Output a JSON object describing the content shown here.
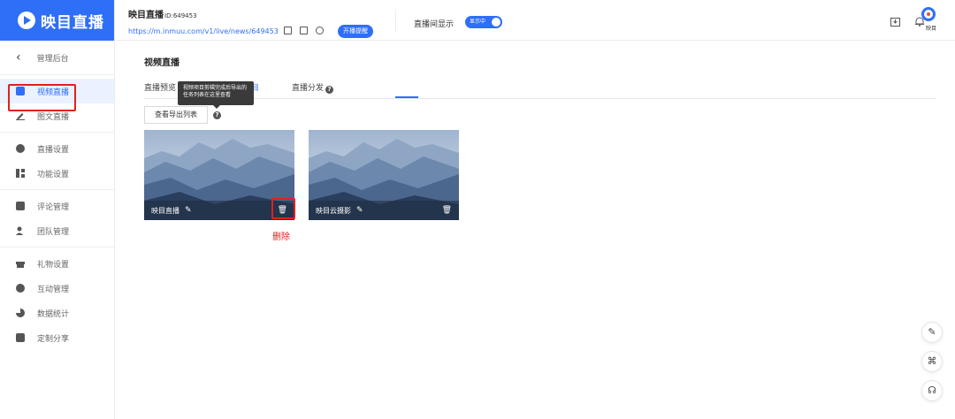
{
  "app": {
    "logo_text": "映目直播"
  },
  "header": {
    "title": "映目直播",
    "id_label": "ID:649453",
    "url": "https://m.inmuu.com/v1/live/news/649453",
    "remind_button": "开播提醒",
    "display_label": "直播间显示",
    "display_toggle": "显示中",
    "avatar_label": "映目"
  },
  "sidebar": {
    "back_label": "管理后台",
    "groups": [
      [
        {
          "label": "视频直播",
          "icon": "play-icon"
        },
        {
          "label": "图文直播",
          "icon": "pen-icon"
        }
      ],
      [
        {
          "label": "直播设置",
          "icon": "settings-icon"
        },
        {
          "label": "功能设置",
          "icon": "grid-icon"
        }
      ],
      [
        {
          "label": "评论管理",
          "icon": "comment-icon"
        },
        {
          "label": "团队管理",
          "icon": "team-icon"
        }
      ],
      [
        {
          "label": "礼物设置",
          "icon": "gift-icon"
        },
        {
          "label": "互动管理",
          "icon": "interact-icon"
        },
        {
          "label": "数据统计",
          "icon": "pie-icon"
        },
        {
          "label": "定制分享",
          "icon": "share-icon"
        }
      ]
    ]
  },
  "main": {
    "page_title": "视频直播",
    "tabs": [
      {
        "label": "直播预览"
      },
      {
        "label": "项目"
      },
      {
        "label": "直播分发"
      }
    ],
    "tooltip": "视频项目剪辑完成后导出的任务列表在这里查看",
    "export_button": "查看导出列表",
    "cards": [
      {
        "title": "映目直播"
      },
      {
        "title": "映目云摄影"
      }
    ],
    "delete_annotation": "删除"
  },
  "colors": {
    "accent": "#2f6ef7",
    "highlight": "#e02020"
  }
}
